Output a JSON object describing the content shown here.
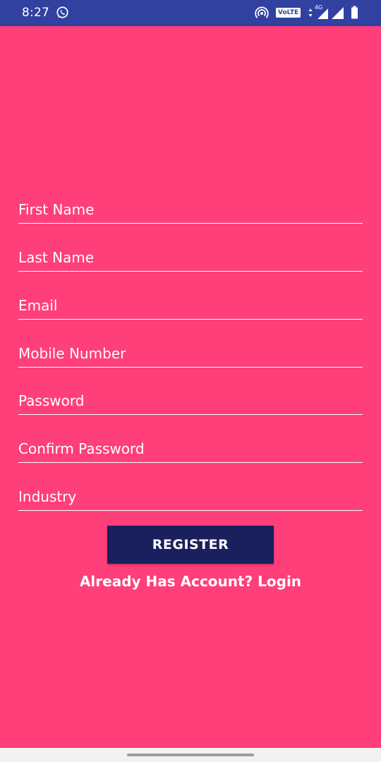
{
  "status_bar": {
    "time": "8:27",
    "volte_label": "VoLTE",
    "network_label": "4G",
    "icons": [
      "whatsapp-icon",
      "hotspot-icon",
      "signal-icon",
      "battery-icon"
    ],
    "background": "#3041A0"
  },
  "form": {
    "background": "#FF3F7A",
    "fields": {
      "first_name": {
        "placeholder": "First Name",
        "value": ""
      },
      "last_name": {
        "placeholder": "Last Name",
        "value": ""
      },
      "email": {
        "placeholder": "Email",
        "value": ""
      },
      "mobile": {
        "placeholder": "Mobile Number",
        "value": ""
      },
      "password": {
        "placeholder": "Password",
        "value": ""
      },
      "confirm_password": {
        "placeholder": "Confirm Password",
        "value": ""
      },
      "industry": {
        "placeholder": "Industry",
        "value": ""
      }
    },
    "register_label": "REGISTER",
    "register_color": "#1A1F5E",
    "login_link": "Already Has Account? Login"
  }
}
